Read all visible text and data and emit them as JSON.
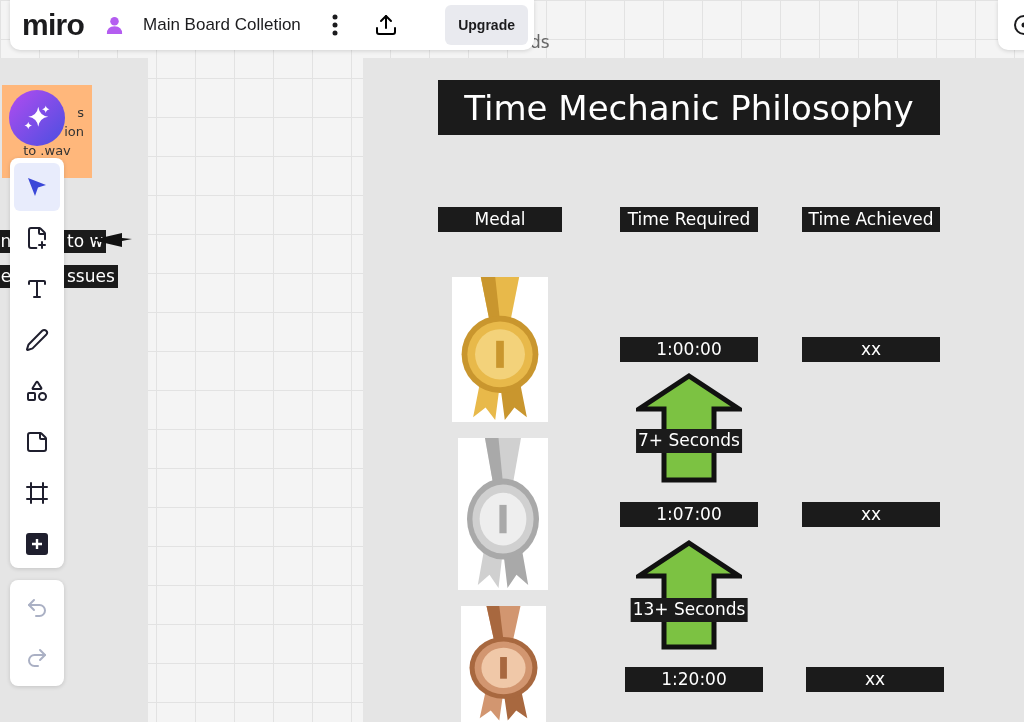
{
  "header": {
    "logo": "miro",
    "board_name": "Main Board Colletion",
    "upgrade": "Upgrade"
  },
  "canvas_fragments": {
    "behind_header": "ds",
    "sticky_note_lines": [
      "s",
      "ion",
      "to .wav"
    ],
    "labels": [
      {
        "left": "n",
        "right": "to w"
      },
      {
        "left": "e",
        "right": "ssues"
      }
    ]
  },
  "toolbar": {
    "tools": [
      {
        "kind": "select",
        "selected": true
      },
      {
        "kind": "note",
        "selected": false
      },
      {
        "kind": "text",
        "selected": false
      },
      {
        "kind": "pen",
        "selected": false
      },
      {
        "kind": "shapes",
        "selected": false
      },
      {
        "kind": "sticky",
        "selected": false
      },
      {
        "kind": "frame",
        "selected": false
      },
      {
        "kind": "more",
        "selected": false
      }
    ],
    "history": [
      {
        "kind": "undo",
        "disabled": true
      },
      {
        "kind": "redo",
        "disabled": true
      }
    ]
  },
  "board": {
    "title": "Time Mechanic Philosophy",
    "columns": [
      "Medal",
      "Time Required",
      "Time Achieved"
    ],
    "rows": [
      {
        "required": "1:00:00",
        "achieved": "xx"
      },
      {
        "required": "1:07:00",
        "achieved": "xx"
      },
      {
        "required": "1:20:00",
        "achieved": "xx"
      }
    ],
    "gaps": [
      "7+ Seconds",
      "13+ Seconds"
    ]
  }
}
